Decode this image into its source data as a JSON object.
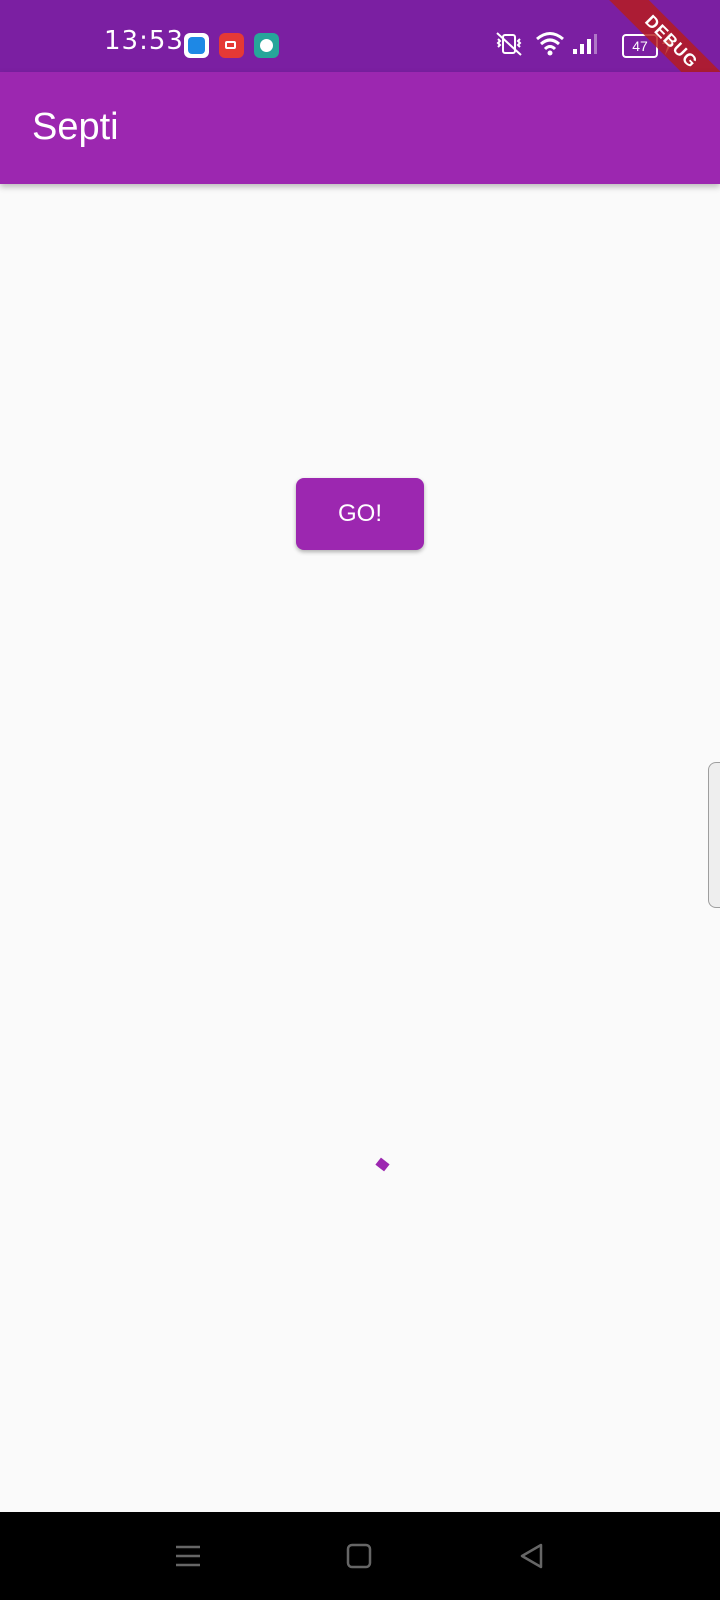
{
  "status_bar": {
    "time": "13:53",
    "battery_level": "47",
    "notification_icons": [
      "app-notification-icon",
      "screen-recorder-icon",
      "chat-notification-icon"
    ],
    "system_icons": [
      "vibrate-icon",
      "wifi-icon",
      "signal-icon",
      "battery-icon",
      "charging-icon"
    ],
    "debug_banner": "DEBUG"
  },
  "app_bar": {
    "title": "Septi"
  },
  "main": {
    "go_button_label": "GO!"
  },
  "navigation_bar": {
    "buttons": [
      "menu-icon",
      "home-icon",
      "back-icon"
    ]
  },
  "colors": {
    "primary": "#9c27b0",
    "status_bar": "#7b1fa2",
    "background": "#fafafa",
    "debug_banner": "#b71c1c"
  }
}
